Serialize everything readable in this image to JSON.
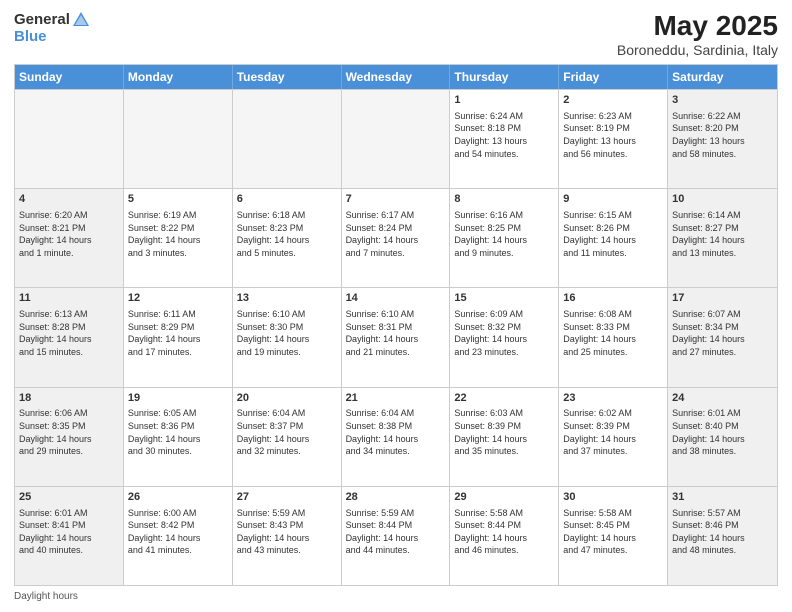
{
  "header": {
    "logo_general": "General",
    "logo_blue": "Blue",
    "title": "May 2025",
    "subtitle": "Boroneddu, Sardinia, Italy"
  },
  "days_of_week": [
    "Sunday",
    "Monday",
    "Tuesday",
    "Wednesday",
    "Thursday",
    "Friday",
    "Saturday"
  ],
  "weeks": [
    [
      {
        "day": "",
        "info": "",
        "empty": true
      },
      {
        "day": "",
        "info": "",
        "empty": true
      },
      {
        "day": "",
        "info": "",
        "empty": true
      },
      {
        "day": "",
        "info": "",
        "empty": true
      },
      {
        "day": "1",
        "info": "Sunrise: 6:24 AM\nSunset: 8:18 PM\nDaylight: 13 hours\nand 54 minutes.",
        "empty": false
      },
      {
        "day": "2",
        "info": "Sunrise: 6:23 AM\nSunset: 8:19 PM\nDaylight: 13 hours\nand 56 minutes.",
        "empty": false
      },
      {
        "day": "3",
        "info": "Sunrise: 6:22 AM\nSunset: 8:20 PM\nDaylight: 13 hours\nand 58 minutes.",
        "empty": false
      }
    ],
    [
      {
        "day": "4",
        "info": "Sunrise: 6:20 AM\nSunset: 8:21 PM\nDaylight: 14 hours\nand 1 minute.",
        "empty": false
      },
      {
        "day": "5",
        "info": "Sunrise: 6:19 AM\nSunset: 8:22 PM\nDaylight: 14 hours\nand 3 minutes.",
        "empty": false
      },
      {
        "day": "6",
        "info": "Sunrise: 6:18 AM\nSunset: 8:23 PM\nDaylight: 14 hours\nand 5 minutes.",
        "empty": false
      },
      {
        "day": "7",
        "info": "Sunrise: 6:17 AM\nSunset: 8:24 PM\nDaylight: 14 hours\nand 7 minutes.",
        "empty": false
      },
      {
        "day": "8",
        "info": "Sunrise: 6:16 AM\nSunset: 8:25 PM\nDaylight: 14 hours\nand 9 minutes.",
        "empty": false
      },
      {
        "day": "9",
        "info": "Sunrise: 6:15 AM\nSunset: 8:26 PM\nDaylight: 14 hours\nand 11 minutes.",
        "empty": false
      },
      {
        "day": "10",
        "info": "Sunrise: 6:14 AM\nSunset: 8:27 PM\nDaylight: 14 hours\nand 13 minutes.",
        "empty": false
      }
    ],
    [
      {
        "day": "11",
        "info": "Sunrise: 6:13 AM\nSunset: 8:28 PM\nDaylight: 14 hours\nand 15 minutes.",
        "empty": false
      },
      {
        "day": "12",
        "info": "Sunrise: 6:11 AM\nSunset: 8:29 PM\nDaylight: 14 hours\nand 17 minutes.",
        "empty": false
      },
      {
        "day": "13",
        "info": "Sunrise: 6:10 AM\nSunset: 8:30 PM\nDaylight: 14 hours\nand 19 minutes.",
        "empty": false
      },
      {
        "day": "14",
        "info": "Sunrise: 6:10 AM\nSunset: 8:31 PM\nDaylight: 14 hours\nand 21 minutes.",
        "empty": false
      },
      {
        "day": "15",
        "info": "Sunrise: 6:09 AM\nSunset: 8:32 PM\nDaylight: 14 hours\nand 23 minutes.",
        "empty": false
      },
      {
        "day": "16",
        "info": "Sunrise: 6:08 AM\nSunset: 8:33 PM\nDaylight: 14 hours\nand 25 minutes.",
        "empty": false
      },
      {
        "day": "17",
        "info": "Sunrise: 6:07 AM\nSunset: 8:34 PM\nDaylight: 14 hours\nand 27 minutes.",
        "empty": false
      }
    ],
    [
      {
        "day": "18",
        "info": "Sunrise: 6:06 AM\nSunset: 8:35 PM\nDaylight: 14 hours\nand 29 minutes.",
        "empty": false
      },
      {
        "day": "19",
        "info": "Sunrise: 6:05 AM\nSunset: 8:36 PM\nDaylight: 14 hours\nand 30 minutes.",
        "empty": false
      },
      {
        "day": "20",
        "info": "Sunrise: 6:04 AM\nSunset: 8:37 PM\nDaylight: 14 hours\nand 32 minutes.",
        "empty": false
      },
      {
        "day": "21",
        "info": "Sunrise: 6:04 AM\nSunset: 8:38 PM\nDaylight: 14 hours\nand 34 minutes.",
        "empty": false
      },
      {
        "day": "22",
        "info": "Sunrise: 6:03 AM\nSunset: 8:39 PM\nDaylight: 14 hours\nand 35 minutes.",
        "empty": false
      },
      {
        "day": "23",
        "info": "Sunrise: 6:02 AM\nSunset: 8:39 PM\nDaylight: 14 hours\nand 37 minutes.",
        "empty": false
      },
      {
        "day": "24",
        "info": "Sunrise: 6:01 AM\nSunset: 8:40 PM\nDaylight: 14 hours\nand 38 minutes.",
        "empty": false
      }
    ],
    [
      {
        "day": "25",
        "info": "Sunrise: 6:01 AM\nSunset: 8:41 PM\nDaylight: 14 hours\nand 40 minutes.",
        "empty": false
      },
      {
        "day": "26",
        "info": "Sunrise: 6:00 AM\nSunset: 8:42 PM\nDaylight: 14 hours\nand 41 minutes.",
        "empty": false
      },
      {
        "day": "27",
        "info": "Sunrise: 5:59 AM\nSunset: 8:43 PM\nDaylight: 14 hours\nand 43 minutes.",
        "empty": false
      },
      {
        "day": "28",
        "info": "Sunrise: 5:59 AM\nSunset: 8:44 PM\nDaylight: 14 hours\nand 44 minutes.",
        "empty": false
      },
      {
        "day": "29",
        "info": "Sunrise: 5:58 AM\nSunset: 8:44 PM\nDaylight: 14 hours\nand 46 minutes.",
        "empty": false
      },
      {
        "day": "30",
        "info": "Sunrise: 5:58 AM\nSunset: 8:45 PM\nDaylight: 14 hours\nand 47 minutes.",
        "empty": false
      },
      {
        "day": "31",
        "info": "Sunrise: 5:57 AM\nSunset: 8:46 PM\nDaylight: 14 hours\nand 48 minutes.",
        "empty": false
      }
    ]
  ],
  "footer": {
    "daylight_hours_label": "Daylight hours"
  }
}
